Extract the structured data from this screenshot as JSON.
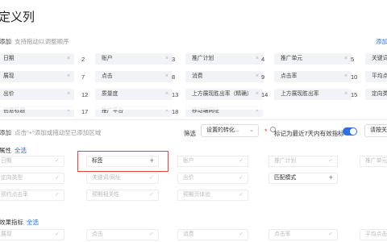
{
  "page": {
    "title": "定义列"
  },
  "selected_section": {
    "label": "添加",
    "hint": "支持拖动以调整顺序",
    "right_link": "添加"
  },
  "selected_rows": [
    [
      {
        "n": "",
        "t": "日期"
      },
      {
        "n": "2",
        "t": "账户"
      },
      {
        "n": "3",
        "t": "推广计划"
      },
      {
        "n": "4",
        "t": "推广单元"
      },
      {
        "n": "5",
        "t": "关键词/定"
      }
    ],
    [
      {
        "n": "",
        "t": "展现"
      },
      {
        "n": "7",
        "t": "点击"
      },
      {
        "n": "8",
        "t": "消费"
      },
      {
        "n": "9",
        "t": "点击率"
      },
      {
        "n": "10",
        "t": "平均点击"
      }
    ],
    [
      {
        "n": "",
        "t": "出价"
      },
      {
        "n": "12",
        "t": "质量度"
      },
      {
        "n": "13",
        "t": "上方展现胜出率（精确）"
      },
      {
        "n": "14",
        "t": "上方展现胜出率"
      },
      {
        "n": "15",
        "t": "定向类型"
      }
    ],
    [
      {
        "n": "",
        "t": "创意标题"
      },
      {
        "n": "17",
        "t": "推广平台"
      },
      {
        "n": "18",
        "t": "移动端网址"
      },
      {
        "n": "",
        "t": ""
      },
      {
        "n": "",
        "t": ""
      }
    ]
  ],
  "available_section": {
    "label": "添加",
    "hint": "点击\"+\"添加或拖动至已添加区域",
    "filter_label": "筛选",
    "filter_value": "设置的转化...",
    "star": "*",
    "metric_label": "标记为最近7天内有效指标",
    "toggle_on": true,
    "button_label": "请按关键"
  },
  "attr_group": {
    "heading": "属性",
    "all_link": "全选",
    "chips": [
      [
        "日期",
        "标签",
        "账户",
        "推广计划",
        "推广单元"
      ],
      [
        "定向类型",
        "关键词/网址",
        "出价",
        "匹配模式",
        ""
      ],
      [
        "预约点击率",
        "预期相关性",
        "预期页体验",
        "",
        ""
      ]
    ]
  },
  "metric_group": {
    "heading": "效果指标",
    "all_link": "全选",
    "chips": [
      "展现",
      "点击",
      "消费",
      "点击率",
      "平均点击价"
    ]
  },
  "icons": {
    "remove": "close-icon",
    "check": "check-icon",
    "add": "plus-icon",
    "chevron": "chevron-down-icon"
  },
  "colors": {
    "accent": "#2a6fe8",
    "highlight": "#e0443e",
    "chip_bg": "#f2f3f6"
  }
}
